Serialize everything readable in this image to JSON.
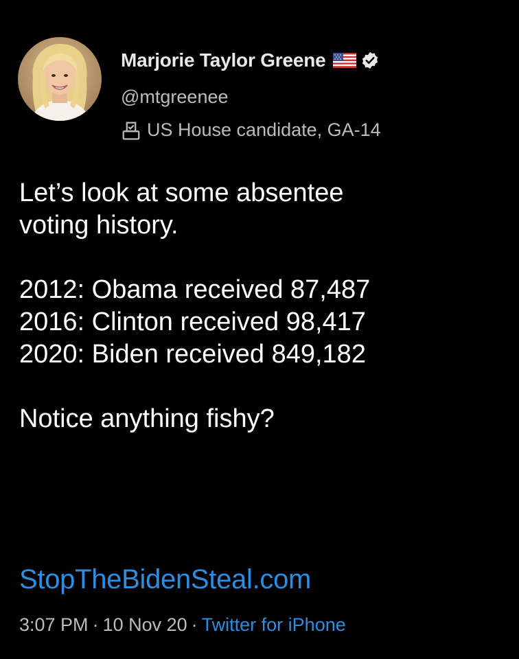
{
  "tweet": {
    "author": {
      "display_name": "Marjorie Taylor Greene",
      "handle": "@mtgreenee",
      "affiliation": "US House candidate, GA-14",
      "icons": {
        "flag": "us-flag-icon",
        "verified": "verified-badge-icon",
        "affiliation": "ballot-box-icon"
      }
    },
    "body": {
      "intro_line_1": "Let’s look at some absentee",
      "intro_line_2": "voting history.",
      "stats": [
        "2012: Obama received 87,487",
        "2016: Clinton received 98,417",
        "2020: Biden received 849,182"
      ],
      "closing": "Notice anything fishy?"
    },
    "link": "StopTheBidenSteal.com",
    "meta": {
      "time": "3:07 PM",
      "separator": "·",
      "date": "10 Nov 20",
      "source": "Twitter for iPhone"
    }
  },
  "colors": {
    "background": "#000000",
    "text_primary": "#ffffff",
    "text_secondary": "#b9bcc0",
    "link": "#2b8ee0"
  }
}
